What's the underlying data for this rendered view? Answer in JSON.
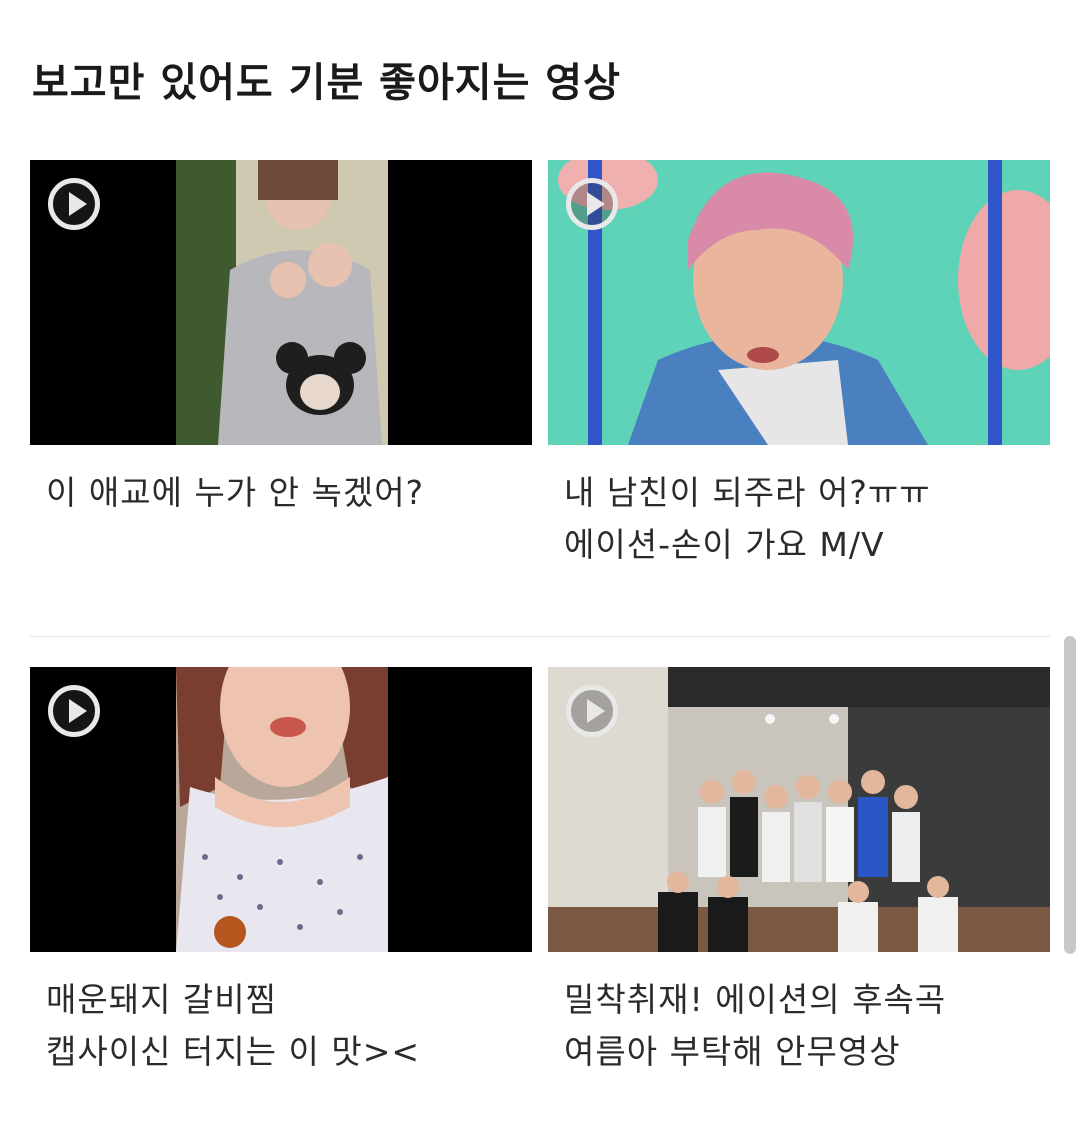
{
  "section": {
    "title": "보고만 있어도 기분 좋아지는 영상"
  },
  "videos": [
    {
      "caption_lines": [
        "이 애교에 누가 안 녹겠어?"
      ],
      "thumbnail": "girl-in-mickey-shirt"
    },
    {
      "caption_lines": [
        "내 남친이 되주라 어?ㅠㅠ",
        "에이션-손이 가요 M/V"
      ],
      "thumbnail": "pink-haired-singer-on-swing"
    },
    {
      "caption_lines": [
        "매운돼지 갈비찜",
        "캡사이신 터지는 이 맛><"
      ],
      "thumbnail": "girl-eating-ribs"
    },
    {
      "caption_lines": [
        "밀착취재! 에이션의 후속곡",
        "여름아 부탁해 안무영상"
      ],
      "thumbnail": "dance-practice-group"
    }
  ],
  "icons": {
    "play": "play-circle-icon"
  },
  "colors": {
    "background": "#ffffff",
    "divider": "#e3e3e3",
    "text": "#2b2b2b"
  }
}
